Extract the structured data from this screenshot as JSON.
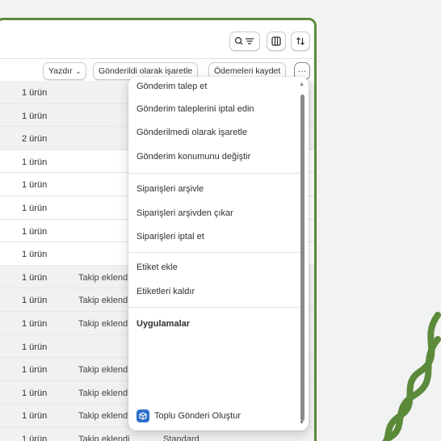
{
  "toolbar": {
    "search_filter_icon": "search-filter-icon",
    "columns_icon": "columns-icon",
    "sort_icon": "sort-icon"
  },
  "actions": {
    "print_label": "Yazdır",
    "mark_shipped_label": "Gönderildi olarak işaretle",
    "save_payments_label": "Ödemeleri kaydet",
    "more_label": "···"
  },
  "rows": [
    {
      "items": "1 ürün",
      "tracking": "",
      "delivery": ""
    },
    {
      "items": "1 ürün",
      "tracking": "",
      "delivery": ""
    },
    {
      "items": "2 ürün",
      "tracking": "",
      "delivery": ""
    },
    {
      "items": "1 ürün",
      "tracking": "",
      "delivery": ""
    },
    {
      "items": "1 ürün",
      "tracking": "",
      "delivery": ""
    },
    {
      "items": "1 ürün",
      "tracking": "",
      "delivery": ""
    },
    {
      "items": "1 ürün",
      "tracking": "",
      "delivery": ""
    },
    {
      "items": "1 ürün",
      "tracking": "",
      "delivery": ""
    },
    {
      "items": "1 ürün",
      "tracking": "Takip eklend",
      "delivery": ""
    },
    {
      "items": "1 ürün",
      "tracking": "Takip eklend",
      "delivery": ""
    },
    {
      "items": "1 ürün",
      "tracking": "Takip eklend",
      "delivery": ""
    },
    {
      "items": "1 ürün",
      "tracking": "",
      "delivery": ""
    },
    {
      "items": "1 ürün",
      "tracking": "Takip eklend",
      "delivery": ""
    },
    {
      "items": "1 ürün",
      "tracking": "Takip eklend",
      "delivery": ""
    },
    {
      "items": "1 ürün",
      "tracking": "Takip eklend",
      "delivery": ""
    },
    {
      "items": "1 ürün",
      "tracking": "Takip eklendi",
      "delivery": "Standard"
    }
  ],
  "menu": {
    "items": [
      "Gönderim talep et",
      "Gönderim taleplerini iptal edin",
      "Gönderilmedi olarak işaretle",
      "Gönderim konumunu değiştir",
      "Siparişleri arşivle",
      "Siparişleri arşivden çıkar",
      "Siparişleri iptal et",
      "Etiket ekle",
      "Etiketleri kaldır"
    ],
    "apps_heading": "Uygulamalar",
    "app_item": "Toplu Gönderi Oluştur"
  },
  "colors": {
    "frame_green": "#5b8a3a",
    "app_icon_blue": "#2c6ecb"
  }
}
